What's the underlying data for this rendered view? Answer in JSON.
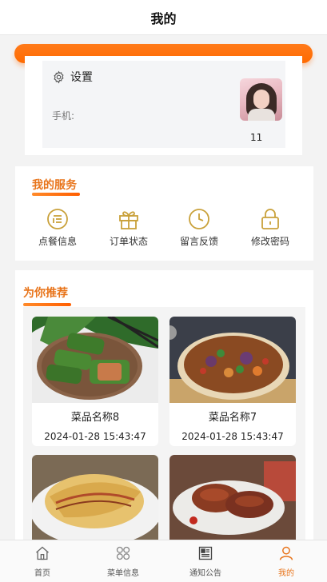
{
  "header": {
    "title": "我的"
  },
  "profile": {
    "settings_label": "设置",
    "phone_label": "手机:",
    "avatar_caption": "11"
  },
  "services": {
    "title": "我的服务",
    "items": [
      {
        "label": "点餐信息",
        "icon": "menu-list-icon"
      },
      {
        "label": "订单状态",
        "icon": "gift-icon"
      },
      {
        "label": "留言反馈",
        "icon": "clock-icon"
      },
      {
        "label": "修改密码",
        "icon": "lock-icon"
      }
    ]
  },
  "recommend": {
    "title": "为你推荐",
    "dishes": [
      {
        "name": "菜品名称8",
        "time": "2024-01-28 15:43:47"
      },
      {
        "name": "菜品名称7",
        "time": "2024-01-28 15:43:47"
      },
      {
        "name": "",
        "time": ""
      },
      {
        "name": "",
        "time": ""
      }
    ]
  },
  "tabbar": {
    "items": [
      {
        "label": "首页",
        "icon": "home-icon",
        "active": false
      },
      {
        "label": "菜单信息",
        "icon": "grid-icon",
        "active": false
      },
      {
        "label": "通知公告",
        "icon": "newspaper-icon",
        "active": false
      },
      {
        "label": "我的",
        "icon": "user-icon",
        "active": true
      }
    ]
  },
  "colors": {
    "accent": "#e8741a",
    "icon_gold": "#c9a13a",
    "orange_bar": "#ff6a00"
  }
}
